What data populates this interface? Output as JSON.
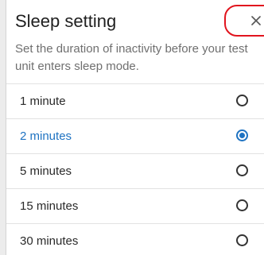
{
  "dialog": {
    "title": "Sleep setting",
    "description": "Set the duration of inactivity before your test unit enters sleep mode.",
    "close_icon": "close-icon",
    "accent_color": "#1f73c2",
    "highlight_color": "#e1141e"
  },
  "options": [
    {
      "label": "1 minute",
      "selected": false
    },
    {
      "label": "2 minutes",
      "selected": true
    },
    {
      "label": "5 minutes",
      "selected": false
    },
    {
      "label": "15 minutes",
      "selected": false
    },
    {
      "label": "30 minutes",
      "selected": false
    }
  ]
}
